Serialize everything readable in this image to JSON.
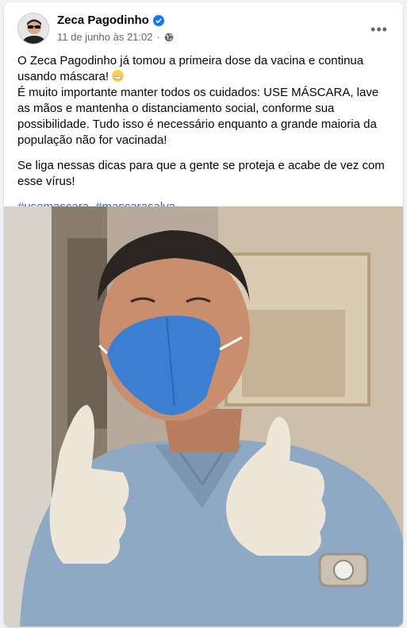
{
  "post": {
    "author": "Zeca Pagodinho",
    "timestamp": "11 de junho às 21:02",
    "separator": "·",
    "more_label": "•••",
    "paragraphs": {
      "p1_line1": "O Zeca Pagodinho já tomou a primeira dose da vacina e continua usando máscara!",
      "p1_line2": "É muito importante manter todos os cuidados: USE MÁSCARA, lave as mãos e mantenha o distanciamento social, conforme sua possibilidade. Tudo isso é necessário enquanto a grande maioria da população não for vacinada!",
      "p2": "Se liga nessas dicas para que a gente se proteja e acabe de vez com esse vírus!"
    },
    "hashtags": [
      "#usemascara",
      "#mascarasalva"
    ],
    "emoji": "mask-face-emoji",
    "icons": {
      "verified": "verified-badge-icon",
      "audience": "globe-icon",
      "more": "more-options-icon"
    }
  },
  "colors": {
    "link": "#216fdb",
    "verified": "#1877f2",
    "meta": "#65676b",
    "mask": "#3b7fd3"
  }
}
